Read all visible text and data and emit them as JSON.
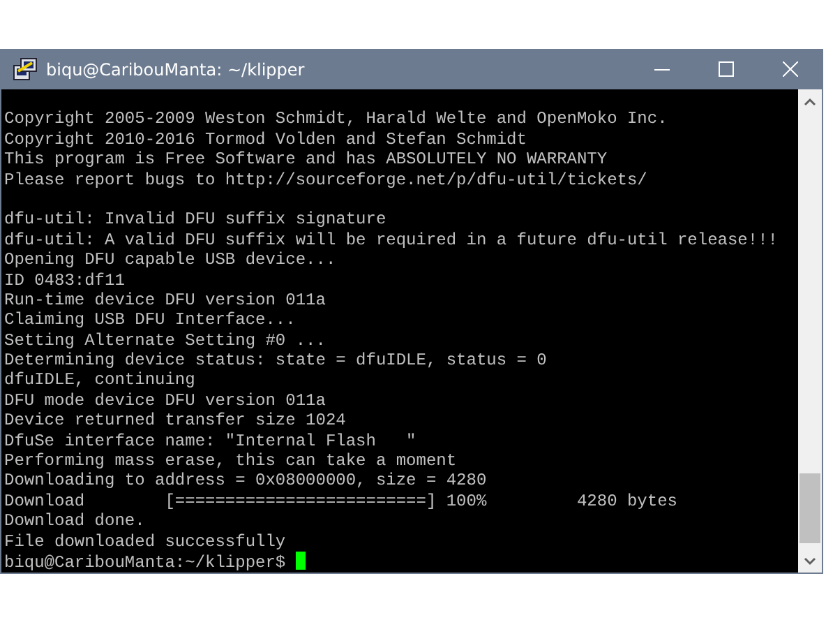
{
  "window": {
    "title": "biqu@CaribouManta: ~/klipper"
  },
  "terminal": {
    "blocks": [
      [
        "Copyright 2005-2009 Weston Schmidt, Harald Welte and OpenMoko Inc.",
        "Copyright 2010-2016 Tormod Volden and Stefan Schmidt",
        "This program is Free Software and has ABSOLUTELY NO WARRANTY",
        "Please report bugs to http://sourceforge.net/p/dfu-util/tickets/"
      ],
      [
        "dfu-util: Invalid DFU suffix signature",
        "dfu-util: A valid DFU suffix will be required in a future dfu-util release!!!",
        "Opening DFU capable USB device...",
        "ID 0483:df11",
        "Run-time device DFU version 011a",
        "Claiming USB DFU Interface...",
        "Setting Alternate Setting #0 ...",
        "Determining device status: state = dfuIDLE, status = 0",
        "dfuIDLE, continuing",
        "DFU mode device DFU version 011a",
        "Device returned transfer size 1024",
        "DfuSe interface name: \"Internal Flash   \"",
        "Performing mass erase, this can take a moment",
        "Downloading to address = 0x08000000, size = 4280",
        "Download        [=========================] 100%         4280 bytes",
        "Download done.",
        "File downloaded successfully"
      ]
    ],
    "prompt": "biqu@CaribouManta:~/klipper$"
  }
}
